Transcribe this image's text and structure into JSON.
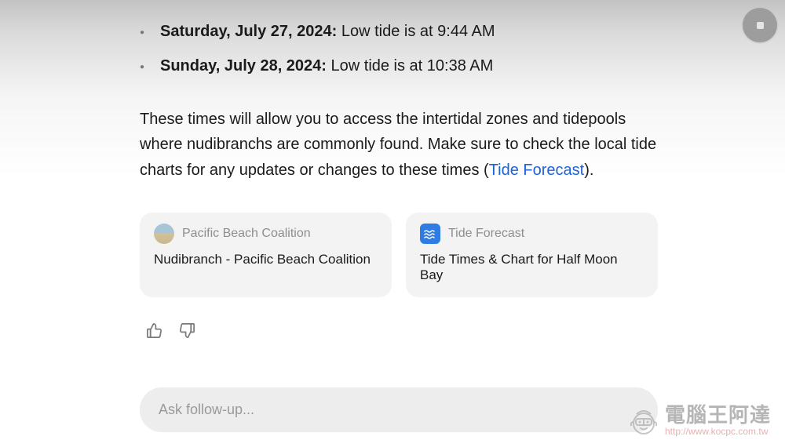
{
  "tide_items": [
    {
      "date": "Saturday, July 27, 2024:",
      "text": " Low tide is at 9:44 AM"
    },
    {
      "date": "Sunday, July 28, 2024:",
      "text": " Low tide is at 10:38 AM"
    }
  ],
  "description": {
    "pre": "These times will allow you to access the intertidal zones and tidepools where nudibranchs are commonly found. Make sure to check the local tide charts for any updates or changes to these times (",
    "link": "Tide Forecast",
    "post": ")."
  },
  "references": [
    {
      "source": "Pacific Beach Coalition",
      "title": "Nudibranch - Pacific Beach Coalition",
      "icon": "beach"
    },
    {
      "source": "Tide Forecast",
      "title": "Tide Times & Chart for Half Moon Bay",
      "icon": "tide"
    }
  ],
  "followup_placeholder": "Ask follow-up...",
  "watermark": {
    "cn": "電腦王阿達",
    "url": "http://www.kocpc.com.tw"
  }
}
